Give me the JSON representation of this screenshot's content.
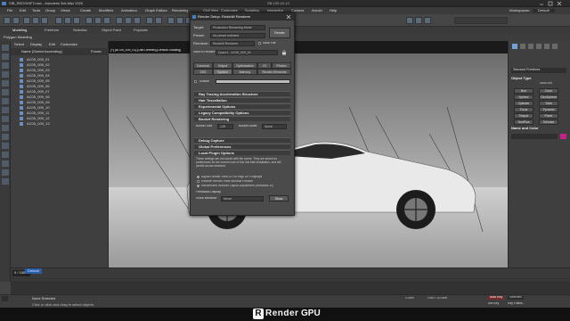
{
  "window": {
    "title": "SIB_REDSHIFT.max - Autodesk 3ds Max 2020",
    "center_title": "SB-109-04-12"
  },
  "menubar": [
    "File",
    "Edit",
    "Tools",
    "Group",
    "Views",
    "Create",
    "Modifiers",
    "Animation",
    "Graph Editors",
    "Rendering",
    "Civil View",
    "Customize",
    "Scripting",
    "Interactive",
    "Content",
    "Arnold",
    "Help"
  ],
  "workspace": {
    "label": "Workspaces:",
    "value": "Default"
  },
  "ribbon_tabs": [
    "Modeling",
    "Freeform",
    "Selection",
    "Object Paint",
    "Populate"
  ],
  "ribbon_sub": "Polygon Modeling",
  "explorer": {
    "tabs": [
      "Select",
      "Display",
      "Edit",
      "Customize"
    ],
    "sort_header": "Name (Sorted Ascending)",
    "frozen_header": "Frozen",
    "items": [
      "AC05_009_01",
      "AC05_009_02",
      "AC05_009_03",
      "AC05_009_04",
      "AC05_009_05",
      "AC05_009_06",
      "AC05_009_07",
      "AC05_009_08",
      "AC05_009_09",
      "AC05_009_10",
      "AC05_009_11",
      "AC05_009_12",
      "AC05_009_13"
    ]
  },
  "viewport": {
    "label": "[+] [AC05_009_01] [Use Defined] [Default Shading]"
  },
  "dialog": {
    "title": "Render Setup: Redshift Renderer",
    "target_label": "Target:",
    "target_value": "Production Rendering Mode",
    "preset_label": "Preset:",
    "preset_value": "No preset selected",
    "renderer_label": "Renderer:",
    "renderer_value": "Redshift Renderer",
    "save_file_label": "Save File",
    "view_label": "View to Render:",
    "view_value": "Quad 4 - AC05_009_01",
    "render_button": "Render",
    "tabs_row1": [
      "Common",
      "Output",
      "Optimization",
      "GI",
      "Photon"
    ],
    "tabs_row2": [
      "SSS",
      "System",
      "Memory",
      "Render Elements"
    ],
    "enable_label": "Enable",
    "rollouts": [
      "Ray Tracing Acceleration Structure",
      "Hair Tessellation",
      "Experimental Options",
      "Legacy Compatibility Options",
      "Bucket Rendering"
    ],
    "bucket_size_label": "Bucket Size",
    "bucket_size_value": "128",
    "bucket_order_label": "Bucket Order",
    "bucket_order_value": "Spiral",
    "rollouts2": [
      "Debug Capture",
      "Global Preferences",
      "Local Plugin Options"
    ],
    "paragraph": "These settings are not stored with the scene. They are stored as preferences for the current user of this 3ds Max installation, and will persist across sessions.",
    "checkboxes": [
      "Adjust Render View UI For High DPI Displays",
      "Restore Render View Window Position",
      "Renderview Window Layout Adjustment (Windows 10)"
    ],
    "feedback_label": "Feedback Display",
    "show_beh_label": "Show Behavior",
    "show_beh_value": "Never",
    "show_button": "Show"
  },
  "command_panel": {
    "dropdown": "Standard Primitives",
    "object_type_label": "Object Type",
    "autogrid_label": "AutoGrid",
    "buttons": [
      "Box",
      "Cone",
      "Sphere",
      "GeoSphere",
      "Cylinder",
      "Tube",
      "Torus",
      "Pyramid",
      "Teapot",
      "Plane",
      "TextPlus",
      "TeNoise"
    ],
    "name_color_label": "Name and Color"
  },
  "timeline": {
    "frame": "0 / 100"
  },
  "status": {
    "selection": "None Selected",
    "prompt": "Click or click-and-drag to select objects",
    "default_label": "Default",
    "coords": {
      "x": "",
      "y": "",
      "z": "0.0cm"
    },
    "grid": "Grid = 10.0cm",
    "autokey": "Auto Key",
    "selected": "Selected",
    "setkey": "Set Key",
    "keyfilters": "Key Filters..."
  },
  "brand": {
    "left": "Render",
    "right": "GPU"
  },
  "colors": {
    "accent": "#4a7fbf",
    "dialog_bg": "#4b4b4b",
    "app_bg": "#444444",
    "magenta_swatch": "#c8208a"
  }
}
